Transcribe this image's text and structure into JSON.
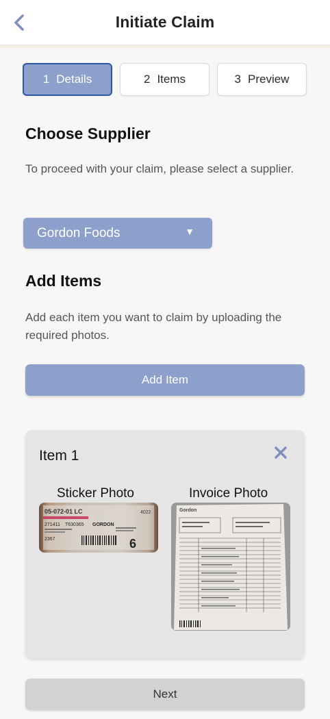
{
  "header": {
    "title": "Initiate Claim",
    "back_icon": "chevron-left-icon"
  },
  "steps": [
    {
      "number": "1",
      "label": "Details",
      "active": true
    },
    {
      "number": "2",
      "label": "Items",
      "active": false
    },
    {
      "number": "3",
      "label": "Preview",
      "active": false
    }
  ],
  "supplier": {
    "title": "Choose Supplier",
    "description": "To proceed with your claim, please select a supplier.",
    "selected": "Gordon Foods",
    "dropdown_icon": "▼"
  },
  "add_items": {
    "title": "Add Items",
    "description": "Add each item you want to claim by uploading the required photos.",
    "button_label": "Add Item"
  },
  "item": {
    "title": "Item 1",
    "sticker_label": "Sticker Photo",
    "invoice_label": "Invoice Photo",
    "sticker_text": {
      "code": "05-072-01 LC",
      "num1": "271411",
      "num2": "T630365",
      "brand": "GORDON",
      "small": "4022",
      "bottom": "2367",
      "digit": "6"
    },
    "invoice_brand": "Gordon"
  },
  "footer": {
    "next_label": "Next"
  },
  "colors": {
    "accent": "#8da0cb",
    "active_border": "#2f56a6",
    "card_bg": "#e5e5e5",
    "next_bg": "#d2d2d2"
  }
}
